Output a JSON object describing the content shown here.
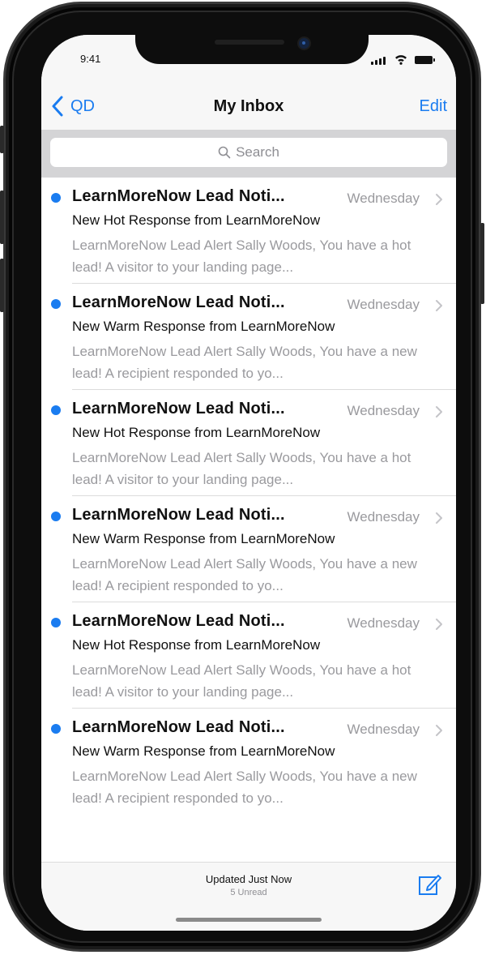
{
  "status_bar": {
    "time": "9:41"
  },
  "nav": {
    "back_label": "QD",
    "title": "My Inbox",
    "edit_label": "Edit"
  },
  "search": {
    "placeholder": "Search"
  },
  "emails": [
    {
      "sender": "LearnMoreNow Lead Noti...",
      "date": "Wednesday",
      "subject": "New Hot Response from LearnMoreNow",
      "preview": "LearnMoreNow Lead Alert Sally Woods, You have a hot lead! A visitor to your landing page...",
      "unread": true
    },
    {
      "sender": "LearnMoreNow Lead Noti...",
      "date": "Wednesday",
      "subject": "New Warm Response from LearnMoreNow",
      "preview": "LearnMoreNow Lead Alert Sally Woods, You have a new lead! A recipient responded to yo...",
      "unread": true
    },
    {
      "sender": "LearnMoreNow Lead Noti...",
      "date": "Wednesday",
      "subject": "New Hot Response from LearnMoreNow",
      "preview": "LearnMoreNow Lead Alert Sally Woods, You have a hot lead! A visitor to your landing page...",
      "unread": true
    },
    {
      "sender": "LearnMoreNow Lead Noti...",
      "date": "Wednesday",
      "subject": "New Warm Response from LearnMoreNow",
      "preview": "LearnMoreNow Lead Alert Sally Woods, You have a new lead! A recipient responded to yo...",
      "unread": true
    },
    {
      "sender": "LearnMoreNow Lead Noti...",
      "date": "Wednesday",
      "subject": "New Hot Response from LearnMoreNow",
      "preview": "LearnMoreNow Lead Alert Sally Woods, You have a hot lead! A visitor to your landing page...",
      "unread": true
    },
    {
      "sender": "LearnMoreNow Lead Noti...",
      "date": "Wednesday",
      "subject": "New Warm Response from LearnMoreNow",
      "preview": "LearnMoreNow Lead Alert Sally Woods, You have a new lead! A recipient responded to yo...",
      "unread": true
    }
  ],
  "footer": {
    "updated": "Updated Just Now",
    "unread_count": "5 Unread"
  },
  "icons": [
    "back-chevron-icon",
    "search-icon",
    "chevron-right-icon",
    "compose-icon",
    "signal-icon",
    "wifi-icon",
    "battery-icon"
  ],
  "colors": {
    "accent": "#1a7cf0",
    "unread_dot": "#1a7cf0",
    "secondary_text": "#9a9a9e",
    "bar_background": "#f7f7f7",
    "search_strip": "#d4d4d6"
  }
}
